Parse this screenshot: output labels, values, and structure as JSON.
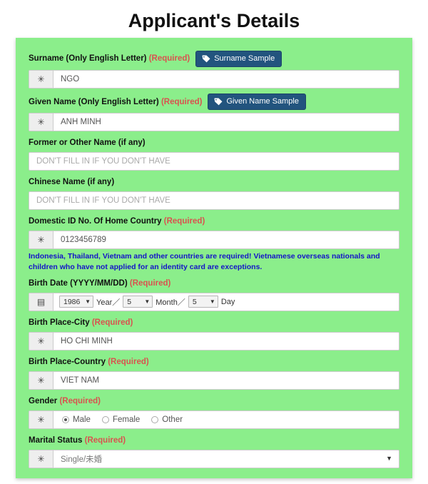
{
  "page": {
    "title": "Applicant's Details",
    "accent_green": "#8bee8b",
    "required_color": "#d9534f",
    "button_color": "#22547e",
    "hint_color": "#1414c8"
  },
  "icons": {
    "asterisk": "✳",
    "calendar": "▤",
    "caret_down": "▼"
  },
  "fields": {
    "surname": {
      "label": "Surname (Only English Letter)",
      "required_tag": "(Required)",
      "sample_button": "Surname Sample",
      "value": "NGO"
    },
    "given_name": {
      "label": "Given Name (Only English Letter)",
      "required_tag": "(Required)",
      "sample_button": "Given Name Sample",
      "value": "ANH MINH"
    },
    "former_name": {
      "label": "Former or Other Name (if any)",
      "placeholder": "DON'T FILL IN IF YOU DON'T HAVE",
      "value": ""
    },
    "chinese_name": {
      "label": "Chinese Name (if any)",
      "placeholder": "DON'T FILL IN IF YOU DON'T HAVE",
      "value": ""
    },
    "domestic_id": {
      "label": "Domestic ID No. Of Home Country",
      "required_tag": "(Required)",
      "value": "0123456789",
      "hint": "Indonesia, Thailand, Vietnam and other countries are required! Vietnamese overseas nationals and children who have not applied for an identity card are exceptions."
    },
    "birth_date": {
      "label": "Birth Date (YYYY/MM/DD)",
      "required_tag": "(Required)",
      "year_value": "1986",
      "year_label": "Year／",
      "month_value": "5",
      "month_label": "Month／",
      "day_value": "5",
      "day_label": "Day"
    },
    "birth_city": {
      "label": "Birth Place-City",
      "required_tag": "(Required)",
      "value": "HO CHI MINH"
    },
    "birth_country": {
      "label": "Birth Place-Country",
      "required_tag": "(Required)",
      "value": "VIET NAM"
    },
    "gender": {
      "label": "Gender",
      "required_tag": "(Required)",
      "options": [
        {
          "label": "Male",
          "selected": true
        },
        {
          "label": "Female",
          "selected": false
        },
        {
          "label": "Other",
          "selected": false
        }
      ],
      "option_male": "Male",
      "option_female": "Female",
      "option_other": "Other"
    },
    "marital_status": {
      "label": "Marital Status",
      "required_tag": "(Required)",
      "value": "Single/未婚"
    }
  }
}
